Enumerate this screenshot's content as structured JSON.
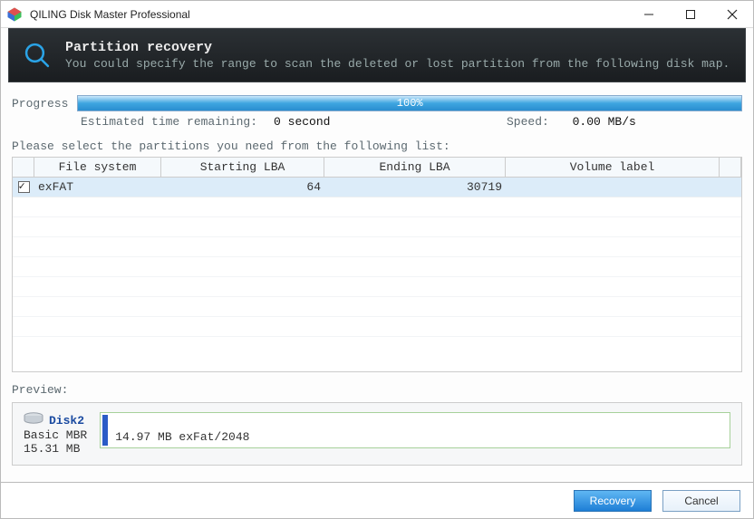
{
  "titlebar": {
    "app_name": "QILING Disk Master Professional"
  },
  "header": {
    "title": "Partition recovery",
    "subtitle": "You could specify the range to scan the deleted or lost partition from the following disk map."
  },
  "progress": {
    "label": "Progress",
    "percent_text": "100%",
    "est_label": "Estimated time remaining:",
    "est_value": "0 second",
    "speed_label": "Speed:",
    "speed_value": "0.00 MB/s"
  },
  "select_prompt": "Please select the partitions you need from the following list:",
  "table": {
    "headers": {
      "fs": "File system",
      "start": "Starting LBA",
      "end": "Ending LBA",
      "vol": "Volume label"
    },
    "rows": [
      {
        "checked": true,
        "fs": "exFAT",
        "start": "64",
        "end": "30719",
        "vol": ""
      }
    ]
  },
  "preview": {
    "label": "Preview:",
    "disk_name": "Disk2",
    "disk_type": "Basic MBR",
    "disk_size": "15.31 MB",
    "bar_caption": "14.97 MB exFat/2048"
  },
  "footer": {
    "recovery": "Recovery",
    "cancel": "Cancel"
  }
}
